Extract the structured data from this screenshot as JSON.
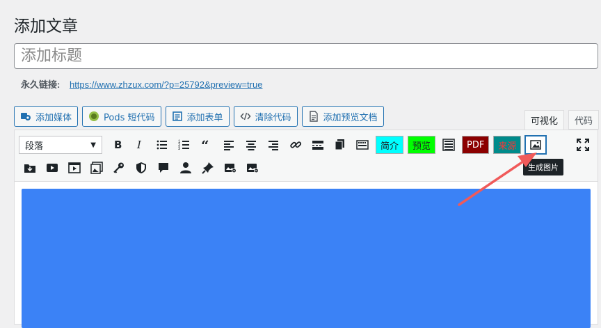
{
  "page_title": "添加文章",
  "title_input": {
    "placeholder": "添加标题",
    "value": ""
  },
  "permalink": {
    "label": "永久链接:",
    "url": "https://www.zhzux.com/?p=25792&preview=true"
  },
  "media_buttons": [
    {
      "label": "添加媒体",
      "icon": "media-icon"
    },
    {
      "label": "Pods 短代码",
      "icon": "pods-icon"
    },
    {
      "label": "添加表单",
      "icon": "form-icon"
    },
    {
      "label": "清除代码",
      "icon": "code-icon"
    },
    {
      "label": "添加预览文档",
      "icon": "document-icon"
    }
  ],
  "tabs": {
    "visual": "可视化",
    "text": "代码"
  },
  "toolbar": {
    "format_select": "段落",
    "custom_buttons": {
      "intro": {
        "label": "简介",
        "bg": "#00ffff",
        "color": "#1d2327"
      },
      "preview": {
        "label": "预览",
        "bg": "#00ff00",
        "color": "#1d2327"
      },
      "pdf": {
        "label": "PDF",
        "bg": "#8b0000",
        "color": "#ffffff"
      },
      "source": {
        "label": "来源",
        "bg": "#008b8b",
        "color": "#ff3333"
      }
    },
    "tooltip": "生成图片"
  },
  "colors": {
    "accent": "#2271b1",
    "content_block": "#3b82f6",
    "arrow": "#f05a5a"
  }
}
